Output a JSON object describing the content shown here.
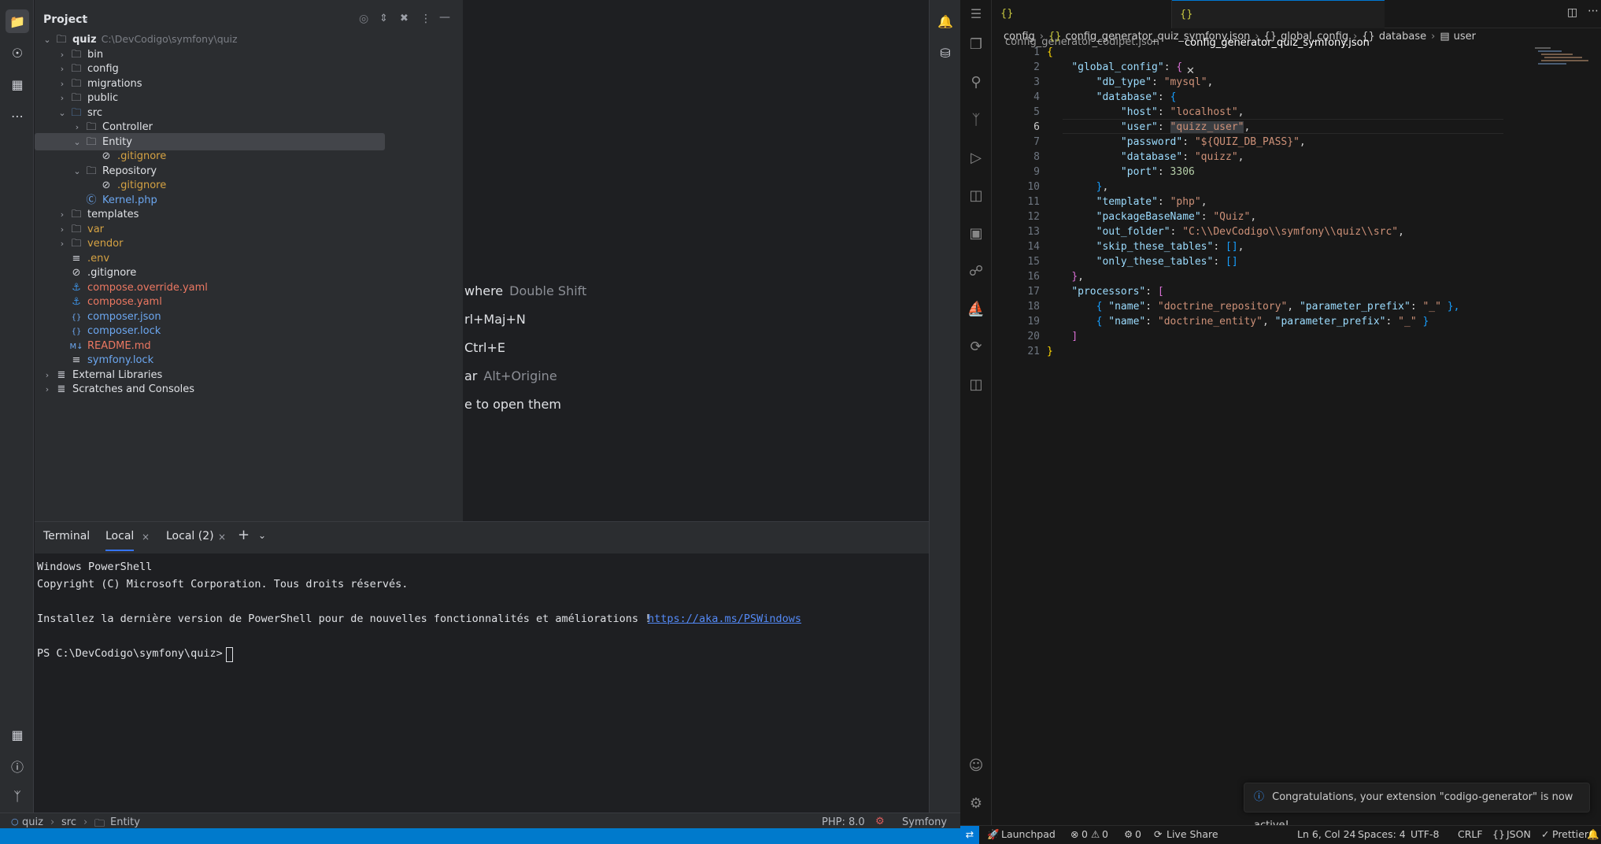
{
  "ide": {
    "project_title": "Project",
    "tree": [
      {
        "label": "quiz",
        "extra": "C:\\DevCodigo\\symfony\\quiz",
        "depth": 0,
        "chev": "open",
        "icon": "folder-icon",
        "color": "#dfe1e5",
        "bold": true
      },
      {
        "label": "bin",
        "depth": 1,
        "chev": "closed",
        "icon": "folder-icon",
        "color": "#dfe1e5"
      },
      {
        "label": "config",
        "depth": 1,
        "chev": "closed",
        "icon": "folder-icon",
        "color": "#dfe1e5"
      },
      {
        "label": "migrations",
        "depth": 1,
        "chev": "closed",
        "icon": "folder-icon",
        "color": "#dfe1e5"
      },
      {
        "label": "public",
        "depth": 1,
        "chev": "closed",
        "icon": "folder-icon",
        "color": "#dfe1e5"
      },
      {
        "label": "src",
        "depth": 1,
        "chev": "open",
        "icon": "source-folder-icon",
        "color": "#dfe1e5"
      },
      {
        "label": "Controller",
        "depth": 2,
        "chev": "closed",
        "icon": "folder-icon",
        "color": "#dfe1e5"
      },
      {
        "label": "Entity",
        "depth": 2,
        "chev": "open",
        "icon": "folder-icon",
        "color": "#dfe1e5",
        "selected": true
      },
      {
        "label": ".gitignore",
        "depth": 3,
        "chev": "none",
        "icon": "ignore-file-icon",
        "color": "#d5a243"
      },
      {
        "label": "Repository",
        "depth": 2,
        "chev": "open",
        "icon": "folder-icon",
        "color": "#dfe1e5"
      },
      {
        "label": ".gitignore",
        "depth": 3,
        "chev": "none",
        "icon": "ignore-file-icon",
        "color": "#d5a243"
      },
      {
        "label": "Kernel.php",
        "depth": 2,
        "chev": "none",
        "icon": "php-class-icon",
        "color": "#6ca7f0"
      },
      {
        "label": "templates",
        "depth": 1,
        "chev": "closed",
        "icon": "folder-icon",
        "color": "#dfe1e5"
      },
      {
        "label": "var",
        "depth": 1,
        "chev": "closed",
        "icon": "folder-icon",
        "color": "#d5a243"
      },
      {
        "label": "vendor",
        "depth": 1,
        "chev": "closed",
        "icon": "folder-icon",
        "color": "#d5a243"
      },
      {
        "label": ".env",
        "depth": 1,
        "chev": "none",
        "icon": "text-file-icon",
        "color": "#d5a243"
      },
      {
        "label": ".gitignore",
        "depth": 1,
        "chev": "none",
        "icon": "ignore-file-icon",
        "color": "#dfe1e5"
      },
      {
        "label": "compose.override.yaml",
        "depth": 1,
        "chev": "none",
        "icon": "docker-icon",
        "color": "#ec7862"
      },
      {
        "label": "compose.yaml",
        "depth": 1,
        "chev": "none",
        "icon": "docker-icon",
        "color": "#ec7862"
      },
      {
        "label": "composer.json",
        "depth": 1,
        "chev": "none",
        "icon": "json-icon",
        "color": "#6ca7f0"
      },
      {
        "label": "composer.lock",
        "depth": 1,
        "chev": "none",
        "icon": "json-icon",
        "color": "#6ca7f0"
      },
      {
        "label": "README.md",
        "depth": 1,
        "chev": "none",
        "icon": "markdown-icon",
        "color": "#ec7862"
      },
      {
        "label": "symfony.lock",
        "depth": 1,
        "chev": "none",
        "icon": "text-file-icon",
        "color": "#6ca7f0"
      },
      {
        "label": "External Libraries",
        "depth": 0,
        "chev": "closed",
        "icon": "library-icon",
        "color": "#dfe1e5"
      },
      {
        "label": "Scratches and Consoles",
        "depth": 0,
        "chev": "closed",
        "icon": "scratches-icon",
        "color": "#dfe1e5"
      }
    ],
    "hints": [
      {
        "text": "where",
        "key": "Double Shift"
      },
      {
        "text": "rl+Maj+N",
        "key": ""
      },
      {
        "text": "Ctrl+E",
        "key": ""
      },
      {
        "text": "ar",
        "key": "Alt+Origine"
      },
      {
        "text": "e to open them",
        "key": ""
      }
    ],
    "terminal": {
      "title": "Terminal",
      "tabs": [
        "Local",
        "Local (2)"
      ],
      "lines": [
        "Windows PowerShell",
        "Copyright (C) Microsoft Corporation. Tous droits réservés.",
        "",
        "Installez la dernière version de PowerShell pour de nouvelles fonctionnalités et améliorations ! ",
        "",
        "PS C:\\DevCodigo\\symfony\\quiz> "
      ],
      "link": "https://aka.ms/PSWindows"
    },
    "status": {
      "crumbs": [
        "quiz",
        "src",
        "Entity"
      ],
      "php": "PHP: 8.0",
      "framework": "Symfony"
    }
  },
  "vscode": {
    "tabs": [
      {
        "label": "config_generator_codipet.json",
        "active": false
      },
      {
        "label": "config_generator_quiz_symfony.json",
        "active": true
      }
    ],
    "breadcrumb": [
      "config",
      "config_generator_quiz_symfony.json",
      "global_config",
      "database",
      "user"
    ],
    "current_line": 6,
    "code": [
      [
        [
          "{",
          "b1"
        ]
      ],
      [
        [
          "    ",
          "p"
        ],
        [
          "\"global_config\"",
          "k"
        ],
        [
          ": ",
          "p"
        ],
        [
          "{",
          "b2"
        ]
      ],
      [
        [
          "        ",
          "p"
        ],
        [
          "\"db_type\"",
          "k"
        ],
        [
          ": ",
          "p"
        ],
        [
          "\"mysql\"",
          "s"
        ],
        [
          ",",
          "p"
        ]
      ],
      [
        [
          "        ",
          "p"
        ],
        [
          "\"database\"",
          "k"
        ],
        [
          ": ",
          "p"
        ],
        [
          "{",
          "b3"
        ]
      ],
      [
        [
          "            ",
          "p"
        ],
        [
          "\"host\"",
          "k"
        ],
        [
          ": ",
          "p"
        ],
        [
          "\"localhost\"",
          "s"
        ],
        [
          ",",
          "p"
        ]
      ],
      [
        [
          "            ",
          "p"
        ],
        [
          "\"user\"",
          "k"
        ],
        [
          ": ",
          "p"
        ],
        [
          "\"quizz_user\"",
          "s"
        ],
        [
          ",",
          "p"
        ]
      ],
      [
        [
          "            ",
          "p"
        ],
        [
          "\"password\"",
          "k"
        ],
        [
          ": ",
          "p"
        ],
        [
          "\"${QUIZ_DB_PASS}\"",
          "s"
        ],
        [
          ",",
          "p"
        ]
      ],
      [
        [
          "            ",
          "p"
        ],
        [
          "\"database\"",
          "k"
        ],
        [
          ": ",
          "p"
        ],
        [
          "\"quizz\"",
          "s"
        ],
        [
          ",",
          "p"
        ]
      ],
      [
        [
          "            ",
          "p"
        ],
        [
          "\"port\"",
          "k"
        ],
        [
          ": ",
          "p"
        ],
        [
          "3306",
          "n"
        ]
      ],
      [
        [
          "        ",
          "p"
        ],
        [
          "}",
          "b3"
        ],
        [
          ",",
          "p"
        ]
      ],
      [
        [
          "        ",
          "p"
        ],
        [
          "\"template\"",
          "k"
        ],
        [
          ": ",
          "p"
        ],
        [
          "\"php\"",
          "s"
        ],
        [
          ",",
          "p"
        ]
      ],
      [
        [
          "        ",
          "p"
        ],
        [
          "\"packageBaseName\"",
          "k"
        ],
        [
          ": ",
          "p"
        ],
        [
          "\"Quiz\"",
          "s"
        ],
        [
          ",",
          "p"
        ]
      ],
      [
        [
          "        ",
          "p"
        ],
        [
          "\"out_folder\"",
          "k"
        ],
        [
          ": ",
          "p"
        ],
        [
          "\"C:\\\\DevCodigo\\\\symfony\\\\quiz\\\\src\"",
          "s"
        ],
        [
          ",",
          "p"
        ]
      ],
      [
        [
          "        ",
          "p"
        ],
        [
          "\"skip_these_tables\"",
          "k"
        ],
        [
          ": ",
          "p"
        ],
        [
          "[]",
          "b3"
        ],
        [
          ",",
          "p"
        ]
      ],
      [
        [
          "        ",
          "p"
        ],
        [
          "\"only_these_tables\"",
          "k"
        ],
        [
          ": ",
          "p"
        ],
        [
          "[]",
          "b3"
        ]
      ],
      [
        [
          "    ",
          "p"
        ],
        [
          "}",
          "b2"
        ],
        [
          ",",
          "p"
        ]
      ],
      [
        [
          "    ",
          "p"
        ],
        [
          "\"processors\"",
          "k"
        ],
        [
          ": ",
          "p"
        ],
        [
          "[",
          "b2"
        ]
      ],
      [
        [
          "        ",
          "p"
        ],
        [
          "{ ",
          "b3"
        ],
        [
          "\"name\"",
          "k"
        ],
        [
          ": ",
          "p"
        ],
        [
          "\"doctrine_repository\"",
          "s"
        ],
        [
          ", ",
          "p"
        ],
        [
          "\"parameter_prefix\"",
          "k"
        ],
        [
          ": ",
          "p"
        ],
        [
          "\"_\"",
          "s"
        ],
        [
          " },",
          "b3"
        ]
      ],
      [
        [
          "        ",
          "p"
        ],
        [
          "{ ",
          "b3"
        ],
        [
          "\"name\"",
          "k"
        ],
        [
          ": ",
          "p"
        ],
        [
          "\"doctrine_entity\"",
          "s"
        ],
        [
          ", ",
          "p"
        ],
        [
          "\"parameter_prefix\"",
          "k"
        ],
        [
          ": ",
          "p"
        ],
        [
          "\"_\"",
          "s"
        ],
        [
          " }",
          "b3"
        ]
      ],
      [
        [
          "    ",
          "p"
        ],
        [
          "]",
          "b2"
        ]
      ],
      [
        [
          "}",
          "b1"
        ]
      ]
    ],
    "toast": "Congratulations, your extension \"codigo-generator\" is now active!",
    "status": {
      "launchpad": "Launchpad",
      "errors": "0",
      "warnings": "0",
      "ports": "0",
      "liveshare": "Live Share",
      "position": "Ln 6, Col 24",
      "spaces": "Spaces: 4",
      "encoding": "UTF-8",
      "eol": "CRLF",
      "language": "JSON",
      "formatter": "Prettier"
    }
  }
}
